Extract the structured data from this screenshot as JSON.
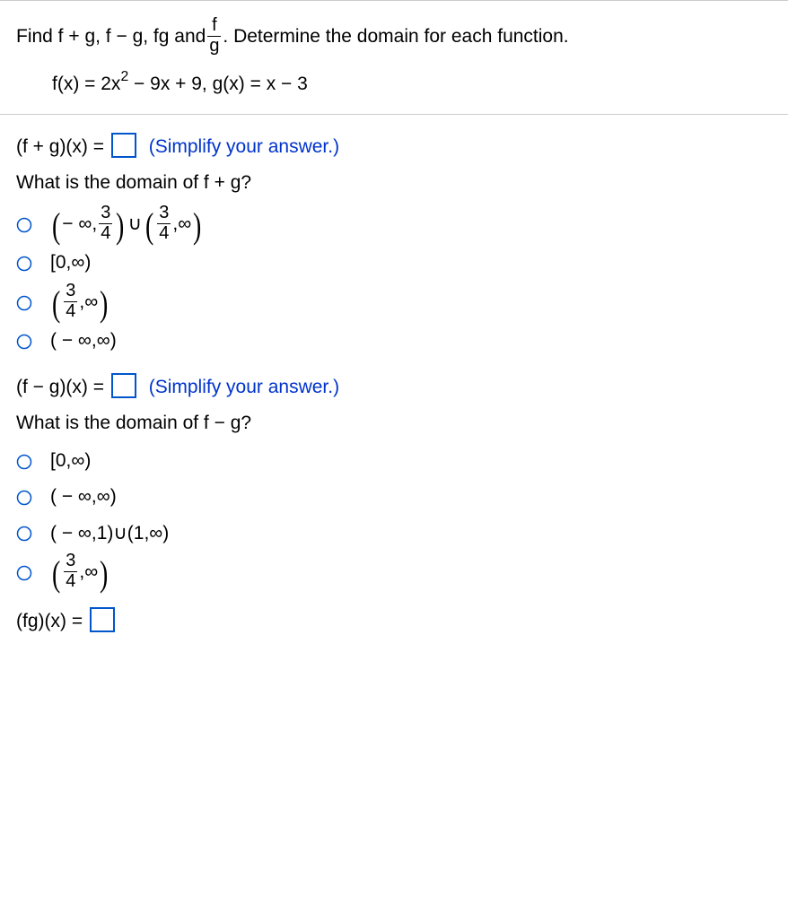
{
  "problem": {
    "intro_a": "Find f + g, f − g, fg and ",
    "frac_num": "f",
    "frac_den": "g",
    "intro_b": ".  Determine the domain for each function.",
    "fx_prefix": "f(x) = 2x",
    "fx_exp": "2",
    "fx_rest": " − 9x + 9, g(x) = x − 3"
  },
  "q1_label": "(f + g)(x) = ",
  "q1_hint": "(Simplify your answer.)",
  "q1_domain_question": "What is the domain of f + g?",
  "q1_options": {
    "a_left_open": "(",
    "a_neg_inf": "− ∞,",
    "a_frac_num": "3",
    "a_frac_den": "4",
    "a_right_close": ")",
    "a_union": "∪",
    "a2_left_open": "(",
    "a2_frac_num": "3",
    "a2_frac_den": "4",
    "a2_rest": ",∞",
    "a2_right_close": ")",
    "b": "[0,∞)",
    "c_left_open": "(",
    "c_frac_num": "3",
    "c_frac_den": "4",
    "c_rest": ",∞",
    "c_right_close": ")",
    "d": "( − ∞,∞)"
  },
  "q2_label": "(f − g)(x) = ",
  "q2_hint": "(Simplify your answer.)",
  "q2_domain_question": "What is the domain of f − g?",
  "q2_options": {
    "a": "[0,∞)",
    "b": "( − ∞,∞)",
    "c": "( − ∞,1)∪(1,∞)",
    "d_left_open": "(",
    "d_frac_num": "3",
    "d_frac_den": "4",
    "d_rest": ",∞",
    "d_right_close": ")"
  },
  "q3_label": "(fg)(x) = "
}
